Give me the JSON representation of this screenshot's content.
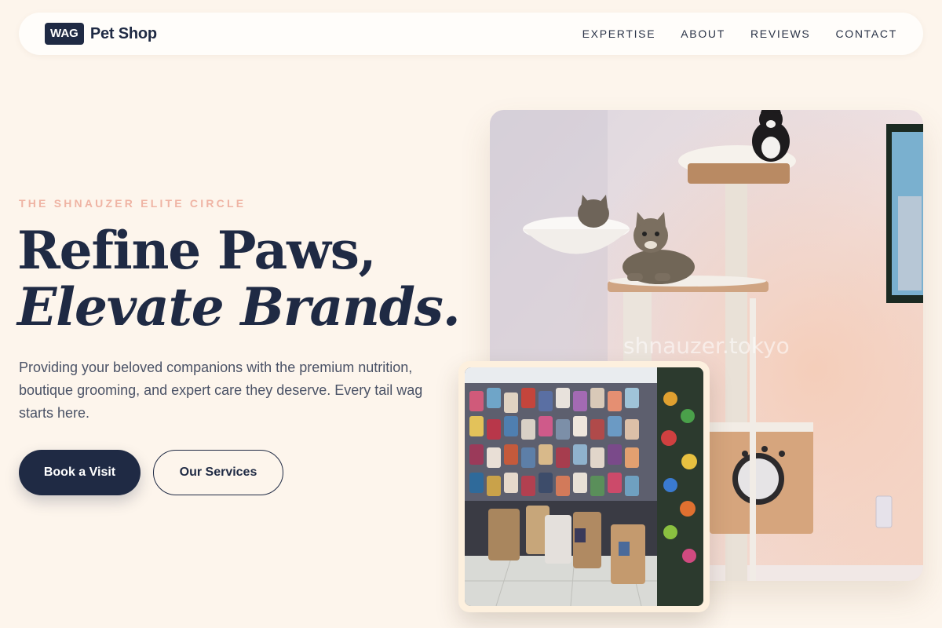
{
  "nav": {
    "brand_badge": "WAG",
    "brand_name": "Pet Shop",
    "links": [
      {
        "label": "EXPERTISE"
      },
      {
        "label": "ABOUT"
      },
      {
        "label": "REVIEWS"
      },
      {
        "label": "CONTACT"
      }
    ]
  },
  "hero": {
    "eyebrow": "THE SHNAUZER ELITE CIRCLE",
    "headline_line1": "Refine Paws,",
    "headline_line2": "Elevate Brands.",
    "description": "Providing your beloved companions with the premium nutrition, boutique grooming, and expert care they deserve. Every tail wag starts here.",
    "primary_cta": "Book a Visit",
    "secondary_cta": "Our Services"
  },
  "images": {
    "main_watermark": "shnauzer.tokyo",
    "main_subject": "cats-on-cat-tree-photo",
    "inset_subject": "pet-shop-interior-photo"
  },
  "colors": {
    "background": "#fdf5ec",
    "navy": "#1f2a44",
    "eyebrow": "#efb4a4",
    "body_text": "#4a5266"
  }
}
